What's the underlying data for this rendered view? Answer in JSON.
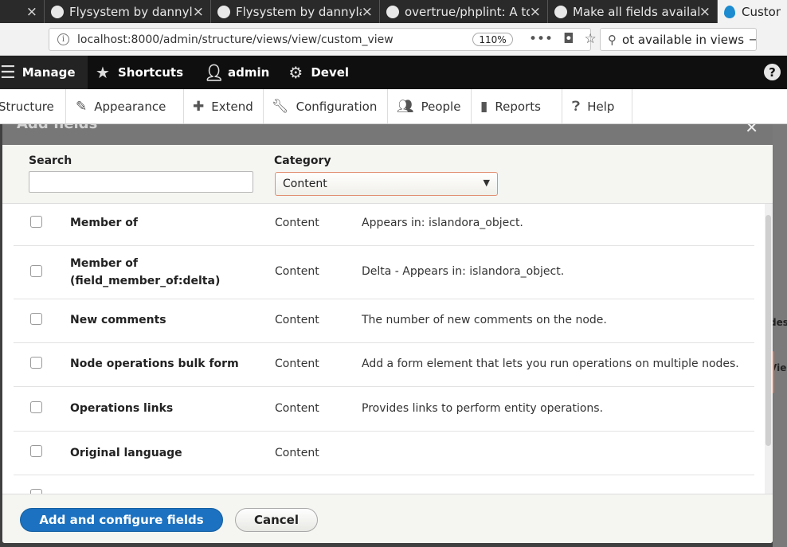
{
  "browser": {
    "tabs": [
      {
        "label": "Flysystem by dannylar",
        "icon": "github-icon"
      },
      {
        "label": "Flysystem by dannylar",
        "icon": "github-icon"
      },
      {
        "label": "overtrue/phplint: A to",
        "icon": "github-icon"
      },
      {
        "label": "Make all fields availab",
        "icon": "github-icon"
      },
      {
        "label": "Custom",
        "icon": "drupal-icon"
      }
    ],
    "close_glyph": "×",
    "url": "localhost:8000/admin/structure/views/view/custom_view",
    "zoom": "110%",
    "search_value": "ot available in views"
  },
  "toolbar": {
    "manage": "Manage",
    "shortcuts": "Shortcuts",
    "user": "admin",
    "devel": "Devel",
    "help": "?"
  },
  "tray": {
    "items": [
      "Structure",
      "Appearance",
      "Extend",
      "Configuration",
      "People",
      "Reports",
      "Help"
    ]
  },
  "dialog": {
    "title": "Add fields",
    "search_label": "Search",
    "search_value": "",
    "category_label": "Category",
    "category_selected": "Content",
    "rows": [
      {
        "name": "Member of",
        "category": "Content",
        "description": "Appears in: islandora_object."
      },
      {
        "name": "Member of (field_member_of:delta)",
        "category": "Content",
        "description": "Delta - Appears in: islandora_object."
      },
      {
        "name": "New comments",
        "category": "Content",
        "description": "The number of new comments on the node."
      },
      {
        "name": "Node operations bulk form",
        "category": "Content",
        "description": "Add a form element that lets you run operations on multiple nodes."
      },
      {
        "name": "Operations links",
        "category": "Content",
        "description": "Provides links to perform entity operations."
      },
      {
        "name": "Original language",
        "category": "Content",
        "description": ""
      }
    ],
    "primary_button": "Add and configure fields",
    "cancel_button": "Cancel"
  },
  "background": {
    "right_edge_texts": [
      "des",
      "Vie"
    ]
  },
  "colors": {
    "primary": "#1c71c0",
    "toolbar": "#0f0f0f",
    "select_border": "#e29073",
    "accent_orange": "#e3744f"
  }
}
